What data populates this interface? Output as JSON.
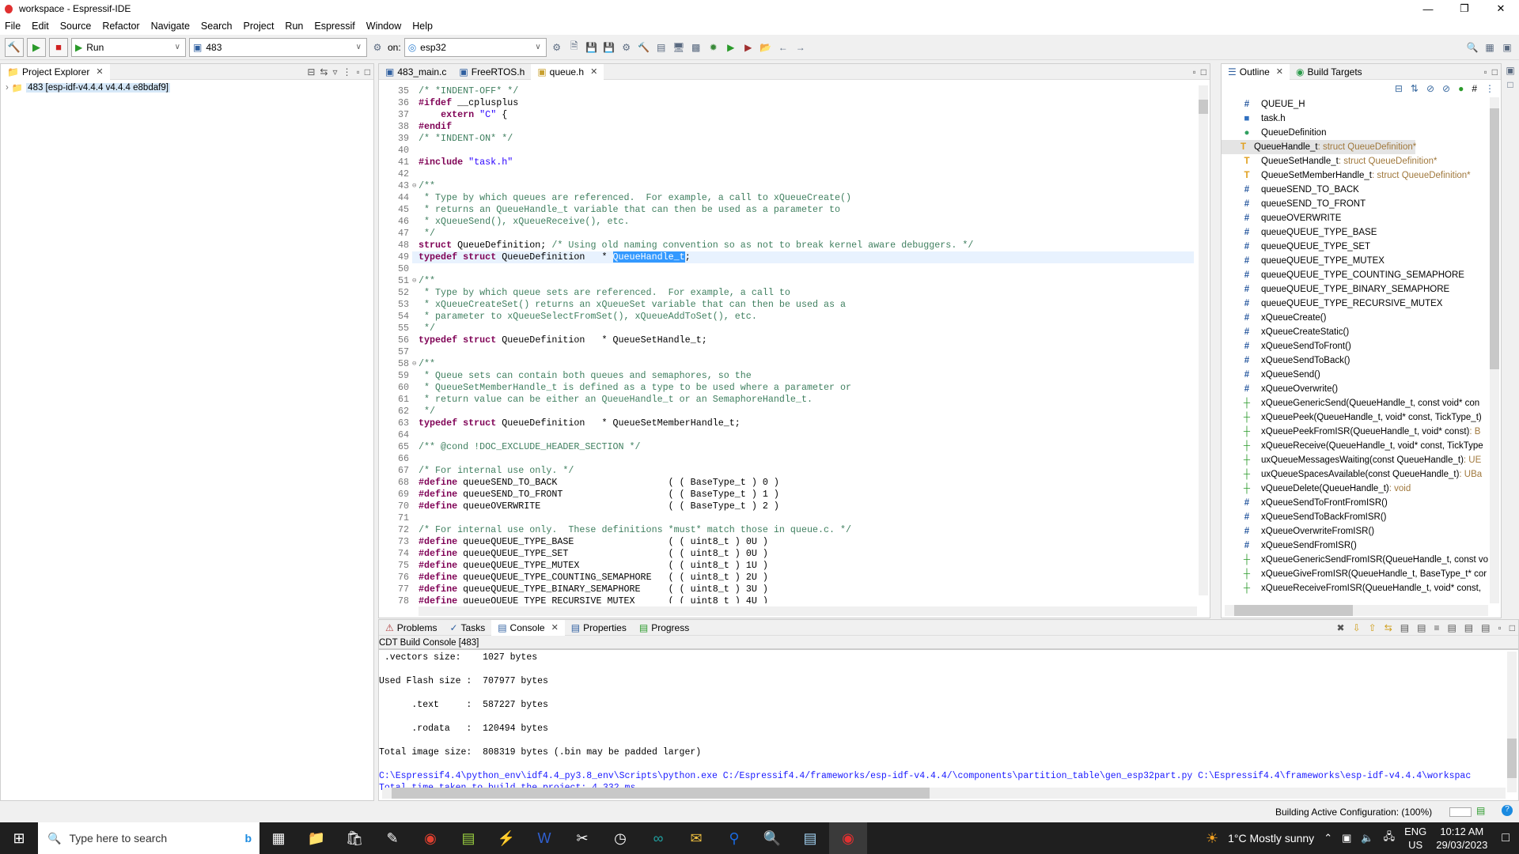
{
  "window": {
    "title": "workspace - Espressif-IDE"
  },
  "menu": [
    "File",
    "Edit",
    "Source",
    "Refactor",
    "Navigate",
    "Search",
    "Project",
    "Run",
    "Espressif",
    "Window",
    "Help"
  ],
  "toolbar": {
    "launch_mode": "Run",
    "launch_config": "483",
    "on_label": "on:",
    "target": "esp32"
  },
  "explorer": {
    "tab": "Project Explorer",
    "project": "483 [esp-idf-v4.4.4 v4.4.4 e8bdaf9]"
  },
  "editor": {
    "tabs": [
      "483_main.c",
      "FreeRTOS.h",
      "queue.h"
    ],
    "active_tab": 2,
    "current_line": 49,
    "lines": [
      {
        "n": 35,
        "s": [
          [
            "c",
            "/* *INDENT-OFF* */"
          ]
        ]
      },
      {
        "n": 36,
        "s": [
          [
            "k",
            "#ifdef"
          ],
          [
            "n",
            " __cplusplus"
          ]
        ]
      },
      {
        "n": 37,
        "s": [
          [
            "n",
            "    "
          ],
          [
            "k",
            "extern"
          ],
          [
            "n",
            " "
          ],
          [
            "s",
            "\"C\""
          ],
          [
            "n",
            " {"
          ]
        ]
      },
      {
        "n": 38,
        "s": [
          [
            "k",
            "#endif"
          ]
        ]
      },
      {
        "n": 39,
        "s": [
          [
            "c",
            "/* *INDENT-ON* */"
          ]
        ]
      },
      {
        "n": 40,
        "s": []
      },
      {
        "n": 41,
        "s": [
          [
            "k",
            "#include"
          ],
          [
            "n",
            " "
          ],
          [
            "s",
            "\"task.h\""
          ]
        ]
      },
      {
        "n": 42,
        "s": []
      },
      {
        "n": 43,
        "f": true,
        "s": [
          [
            "c",
            "/**"
          ]
        ]
      },
      {
        "n": 44,
        "s": [
          [
            "c",
            " * Type by which queues are referenced.  For example, a call to xQueueCreate()"
          ]
        ]
      },
      {
        "n": 45,
        "s": [
          [
            "c",
            " * returns an QueueHandle_t variable that can then be used as a parameter to"
          ]
        ]
      },
      {
        "n": 46,
        "s": [
          [
            "c",
            " * xQueueSend(), xQueueReceive(), etc."
          ]
        ]
      },
      {
        "n": 47,
        "s": [
          [
            "c",
            " */"
          ]
        ]
      },
      {
        "n": 48,
        "s": [
          [
            "k",
            "struct"
          ],
          [
            "n",
            " QueueDefinition; "
          ],
          [
            "c",
            "/* Using old naming convention so as not to break kernel aware debuggers. */"
          ]
        ]
      },
      {
        "n": 49,
        "s": [
          [
            "k",
            "typedef"
          ],
          [
            "n",
            " "
          ],
          [
            "k",
            "struct"
          ],
          [
            "n",
            " QueueDefinition   * "
          ],
          [
            "sel",
            "QueueHandle_t"
          ],
          [
            "n",
            ";"
          ]
        ]
      },
      {
        "n": 50,
        "s": []
      },
      {
        "n": 51,
        "f": true,
        "s": [
          [
            "c",
            "/**"
          ]
        ]
      },
      {
        "n": 52,
        "s": [
          [
            "c",
            " * Type by which queue sets are referenced.  For example, a call to"
          ]
        ]
      },
      {
        "n": 53,
        "s": [
          [
            "c",
            " * xQueueCreateSet() returns an xQueueSet variable that can then be used as a"
          ]
        ]
      },
      {
        "n": 54,
        "s": [
          [
            "c",
            " * parameter to xQueueSelectFromSet(), xQueueAddToSet(), etc."
          ]
        ]
      },
      {
        "n": 55,
        "s": [
          [
            "c",
            " */"
          ]
        ]
      },
      {
        "n": 56,
        "s": [
          [
            "k",
            "typedef"
          ],
          [
            "n",
            " "
          ],
          [
            "k",
            "struct"
          ],
          [
            "n",
            " QueueDefinition   * QueueSetHandle_t;"
          ]
        ]
      },
      {
        "n": 57,
        "s": []
      },
      {
        "n": 58,
        "f": true,
        "s": [
          [
            "c",
            "/**"
          ]
        ]
      },
      {
        "n": 59,
        "s": [
          [
            "c",
            " * Queue sets can contain both queues and semaphores, so the"
          ]
        ]
      },
      {
        "n": 60,
        "s": [
          [
            "c",
            " * QueueSetMemberHandle_t is defined as a type to be used where a parameter or"
          ]
        ]
      },
      {
        "n": 61,
        "s": [
          [
            "c",
            " * return value can be either an QueueHandle_t or an SemaphoreHandle_t."
          ]
        ]
      },
      {
        "n": 62,
        "s": [
          [
            "c",
            " */"
          ]
        ]
      },
      {
        "n": 63,
        "s": [
          [
            "k",
            "typedef"
          ],
          [
            "n",
            " "
          ],
          [
            "k",
            "struct"
          ],
          [
            "n",
            " QueueDefinition   * QueueSetMemberHandle_t;"
          ]
        ]
      },
      {
        "n": 64,
        "s": []
      },
      {
        "n": 65,
        "s": [
          [
            "c",
            "/** @cond !DOC_EXCLUDE_HEADER_SECTION */"
          ]
        ]
      },
      {
        "n": 66,
        "s": []
      },
      {
        "n": 67,
        "s": [
          [
            "c",
            "/* For internal use only. */"
          ]
        ]
      },
      {
        "n": 68,
        "s": [
          [
            "k",
            "#define"
          ],
          [
            "n",
            " queueSEND_TO_BACK                    ( ( BaseType_t ) 0 )"
          ]
        ]
      },
      {
        "n": 69,
        "s": [
          [
            "k",
            "#define"
          ],
          [
            "n",
            " queueSEND_TO_FRONT                   ( ( BaseType_t ) 1 )"
          ]
        ]
      },
      {
        "n": 70,
        "s": [
          [
            "k",
            "#define"
          ],
          [
            "n",
            " queueOVERWRITE                       ( ( BaseType_t ) 2 )"
          ]
        ]
      },
      {
        "n": 71,
        "s": []
      },
      {
        "n": 72,
        "s": [
          [
            "c",
            "/* For internal use only.  These definitions *must* match those in queue.c. */"
          ]
        ]
      },
      {
        "n": 73,
        "s": [
          [
            "k",
            "#define"
          ],
          [
            "n",
            " queueQUEUE_TYPE_BASE                 ( ( uint8_t ) 0U )"
          ]
        ]
      },
      {
        "n": 74,
        "s": [
          [
            "k",
            "#define"
          ],
          [
            "n",
            " queueQUEUE_TYPE_SET                  ( ( uint8_t ) 0U )"
          ]
        ]
      },
      {
        "n": 75,
        "s": [
          [
            "k",
            "#define"
          ],
          [
            "n",
            " queueQUEUE_TYPE_MUTEX                ( ( uint8_t ) 1U )"
          ]
        ]
      },
      {
        "n": 76,
        "s": [
          [
            "k",
            "#define"
          ],
          [
            "n",
            " queueQUEUE_TYPE_COUNTING_SEMAPHORE   ( ( uint8_t ) 2U )"
          ]
        ]
      },
      {
        "n": 77,
        "s": [
          [
            "k",
            "#define"
          ],
          [
            "n",
            " queueQUEUE_TYPE_BINARY_SEMAPHORE     ( ( uint8_t ) 3U )"
          ]
        ]
      },
      {
        "n": 78,
        "s": [
          [
            "k",
            "#define"
          ],
          [
            "n",
            " queueQUEUE_TYPE_RECURSIVE_MUTEX      ( ( uint8_t ) 4U )"
          ]
        ]
      }
    ]
  },
  "outline": {
    "tabs": [
      "Outline",
      "Build Targets"
    ],
    "items": [
      {
        "icon": "macro",
        "name": "QUEUE_H"
      },
      {
        "icon": "include",
        "name": "task.h"
      },
      {
        "icon": "struct",
        "name": "QueueDefinition"
      },
      {
        "icon": "typedef",
        "name": "QueueHandle_t",
        "type": " : struct QueueDefinition*",
        "selected": true
      },
      {
        "icon": "typedef",
        "name": "QueueSetHandle_t",
        "type": " : struct QueueDefinition*"
      },
      {
        "icon": "typedef",
        "name": "QueueSetMemberHandle_t",
        "type": " : struct QueueDefinition*"
      },
      {
        "icon": "macro",
        "name": "queueSEND_TO_BACK"
      },
      {
        "icon": "macro",
        "name": "queueSEND_TO_FRONT"
      },
      {
        "icon": "macro",
        "name": "queueOVERWRITE"
      },
      {
        "icon": "macro",
        "name": "queueQUEUE_TYPE_BASE"
      },
      {
        "icon": "macro",
        "name": "queueQUEUE_TYPE_SET"
      },
      {
        "icon": "macro",
        "name": "queueQUEUE_TYPE_MUTEX"
      },
      {
        "icon": "macro",
        "name": "queueQUEUE_TYPE_COUNTING_SEMAPHORE"
      },
      {
        "icon": "macro",
        "name": "queueQUEUE_TYPE_BINARY_SEMAPHORE"
      },
      {
        "icon": "macro",
        "name": "queueQUEUE_TYPE_RECURSIVE_MUTEX"
      },
      {
        "icon": "macro",
        "name": "xQueueCreate()"
      },
      {
        "icon": "macro",
        "name": "xQueueCreateStatic()"
      },
      {
        "icon": "macro",
        "name": "xQueueSendToFront()"
      },
      {
        "icon": "macro",
        "name": "xQueueSendToBack()"
      },
      {
        "icon": "macro",
        "name": "xQueueSend()"
      },
      {
        "icon": "macro",
        "name": "xQueueOverwrite()"
      },
      {
        "icon": "function",
        "name": "xQueueGenericSend(QueueHandle_t, const void* con"
      },
      {
        "icon": "function",
        "name": "xQueuePeek(QueueHandle_t, void* const, TickType_t)"
      },
      {
        "icon": "function",
        "name": "xQueuePeekFromISR(QueueHandle_t, void* const)",
        "type": " : B"
      },
      {
        "icon": "function",
        "name": "xQueueReceive(QueueHandle_t, void* const, TickType"
      },
      {
        "icon": "function",
        "name": "uxQueueMessagesWaiting(const QueueHandle_t)",
        "type": " : UE"
      },
      {
        "icon": "function",
        "name": "uxQueueSpacesAvailable(const QueueHandle_t)",
        "type": " : UBa"
      },
      {
        "icon": "function",
        "name": "vQueueDelete(QueueHandle_t)",
        "type": " : void"
      },
      {
        "icon": "macro",
        "name": "xQueueSendToFrontFromISR()"
      },
      {
        "icon": "macro",
        "name": "xQueueSendToBackFromISR()"
      },
      {
        "icon": "macro",
        "name": "xQueueOverwriteFromISR()"
      },
      {
        "icon": "macro",
        "name": "xQueueSendFromISR()"
      },
      {
        "icon": "function",
        "name": "xQueueGenericSendFromISR(QueueHandle_t, const vo"
      },
      {
        "icon": "function",
        "name": "xQueueGiveFromISR(QueueHandle_t, BaseType_t* cor"
      },
      {
        "icon": "function",
        "name": "xQueueReceiveFromISR(QueueHandle_t, void* const,"
      }
    ]
  },
  "bottom": {
    "tabs": [
      "Problems",
      "Tasks",
      "Console",
      "Properties",
      "Progress"
    ],
    "active_tab": 2,
    "console_title": "CDT Build Console [483]",
    "lines": [
      {
        "t": " .vectors size:    1027 bytes"
      },
      {
        "t": ""
      },
      {
        "t": "Used Flash size :  707977 bytes"
      },
      {
        "t": ""
      },
      {
        "t": "      .text     :  587227 bytes"
      },
      {
        "t": ""
      },
      {
        "t": "      .rodata   :  120494 bytes"
      },
      {
        "t": ""
      },
      {
        "t": "Total image size:  808319 bytes (.bin may be padded larger)"
      },
      {
        "t": ""
      },
      {
        "t": "C:\\Espressif4.4\\python_env\\idf4.4_py3.8_env\\Scripts\\python.exe C:/Espressif4.4/frameworks/esp-idf-v4.4.4/\\components\\partition_table\\gen_esp32part.py C:\\Espressif4.4\\frameworks\\esp-idf-v4.4.4\\workspac",
        "blue": true
      },
      {
        "t": "Total time taken to build the project: 4,332 ms",
        "blue": true
      }
    ]
  },
  "status": {
    "text": "Building Active Configuration: (100%)"
  },
  "taskbar": {
    "search_placeholder": "Type here to search",
    "weather": "1°C  Mostly sunny",
    "lang1": "ENG",
    "lang2": "US",
    "time": "10:12 AM",
    "date": "29/03/2023"
  }
}
